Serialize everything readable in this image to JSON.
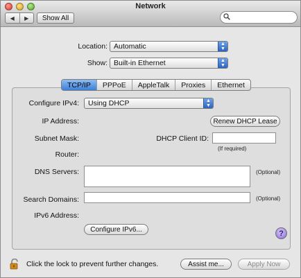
{
  "window": {
    "title": "Network"
  },
  "toolbar": {
    "show_all_label": "Show All",
    "back_icon": "◀",
    "forward_icon": "▶",
    "search_placeholder": ""
  },
  "location": {
    "label": "Location:",
    "value": "Automatic"
  },
  "show": {
    "label": "Show:",
    "value": "Built-in Ethernet"
  },
  "tabs": [
    {
      "label": "TCP/IP",
      "active": true
    },
    {
      "label": "PPPoE",
      "active": false
    },
    {
      "label": "AppleTalk",
      "active": false
    },
    {
      "label": "Proxies",
      "active": false
    },
    {
      "label": "Ethernet",
      "active": false
    }
  ],
  "tcpip": {
    "configure_ipv4_label": "Configure IPv4:",
    "configure_ipv4_value": "Using DHCP",
    "ip_address_label": "IP Address:",
    "renew_button": "Renew DHCP Lease",
    "subnet_mask_label": "Subnet Mask:",
    "dhcp_client_id_label": "DHCP Client ID:",
    "if_required": "(If required)",
    "router_label": "Router:",
    "dns_servers_label": "DNS Servers:",
    "dns_optional": "(Optional)",
    "search_domains_label": "Search Domains:",
    "search_optional": "(Optional)",
    "ipv6_address_label": "IPv6 Address:",
    "configure_ipv6_button": "Configure IPv6...",
    "help": "?"
  },
  "footer": {
    "lock_text": "Click the lock to prevent further changes.",
    "assist_button": "Assist me...",
    "apply_button": "Apply Now"
  },
  "colors": {
    "accent": "#3e7fd8",
    "help_button": "#8a68d8",
    "lock": "#d08a1c"
  }
}
